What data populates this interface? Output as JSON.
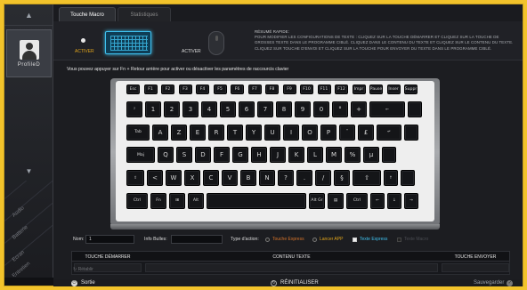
{
  "sidebar": {
    "up_arrow": "▲",
    "down_arrow": "▼",
    "profile_label": "ProfileD",
    "diagonal_items": [
      "Audio",
      "Batterie",
      "Ecran",
      "Entretien"
    ]
  },
  "tabs": [
    {
      "label": "Touche Macro",
      "active": true
    },
    {
      "label": "Statistiques",
      "active": false
    }
  ],
  "mode": {
    "left_activer": "ACTIVER",
    "right_activer": "ACTIVER",
    "description_title": "Résumé rapide:",
    "description": "Pour modifier les configurations de texte : Cliquez sur la TOUCHE DÉMARRER et cliquez sur la touche de grosses texte dans le programme ciblé. Cliquez dans le CONTENU DU TEXTE et cliquez sur le contenu du texte. Cliquez sur TOUCHE D'ENVOI et cliquez sur la touche pour envoyer du texte dans le programme ciblé."
  },
  "instruction": "Vous pouvez appuyer sur Fn + Retour arrière pour activer ou désactiver les paramètres de raccourcis clavier",
  "keyboard": {
    "row0": [
      "Esc",
      "F1",
      "F2",
      "F3",
      "F4",
      "F5",
      "F6",
      "F7",
      "F8",
      "F9",
      "F10",
      "F11",
      "F12",
      "Impr",
      "Pause",
      "Inser",
      "Suppr"
    ],
    "row1": [
      "²",
      "1",
      "2",
      "3",
      "4",
      "5",
      "6",
      "7",
      "8",
      "9",
      "0",
      "°",
      "+",
      "←",
      ""
    ],
    "row2": [
      "Tab",
      "A",
      "Z",
      "E",
      "R",
      "T",
      "Y",
      "U",
      "I",
      "O",
      "P",
      "¨",
      "£",
      "↵",
      ""
    ],
    "row3": [
      "Maj",
      "Q",
      "S",
      "D",
      "F",
      "G",
      "H",
      "J",
      "K",
      "L",
      "M",
      "%",
      "µ",
      ""
    ],
    "row4": [
      "⇧",
      "<",
      "W",
      "X",
      "C",
      "V",
      "B",
      "N",
      "?",
      ".",
      "/",
      "§",
      "⇧",
      "↑",
      ""
    ],
    "row5": [
      "Ctrl",
      "Fn",
      "⊞",
      "Alt",
      "",
      "Alt Gr",
      "▤",
      "Ctrl",
      "←",
      "↓",
      "→"
    ]
  },
  "form": {
    "nom_label": "Nom:",
    "nom_value": "1",
    "info_label": "Info Bulles:",
    "info_value": "",
    "type_label": "Type d'action:",
    "options": [
      {
        "label": "Touche Express",
        "color": "#d8742a"
      },
      {
        "label": "Lancer APP",
        "color": "#e2a51a"
      },
      {
        "label": "Texte Express",
        "color": "#3fc1ef"
      },
      {
        "label": "Texte Macro",
        "color": "#4a4c52"
      }
    ]
  },
  "table": {
    "headers": [
      "Touche démarrer",
      "Contenu texte",
      "Touche envoyer"
    ]
  },
  "retablir": "Rétablir",
  "bottom": {
    "exit": "Sortie",
    "reset": "RÉINITIALISER",
    "save": "Sauvegarder"
  }
}
